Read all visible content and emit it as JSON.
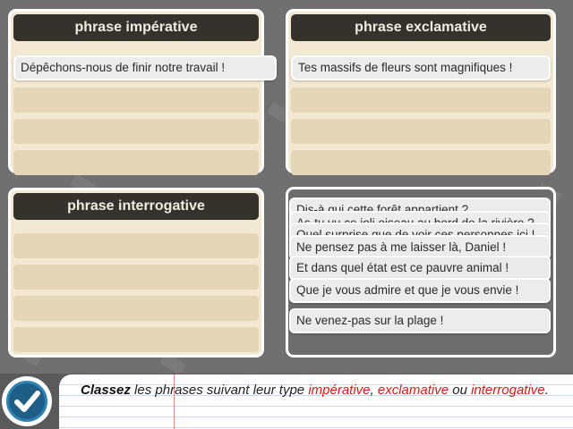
{
  "panels": {
    "imperative": {
      "title": "phrase impérative",
      "items": [
        "Dépêchons-nous de finir notre travail !"
      ]
    },
    "exclamative": {
      "title": "phrase exclamative",
      "items": [
        "Tes massifs de fleurs sont magnifiques !"
      ]
    },
    "interrogative": {
      "title": "phrase interrogative",
      "items": []
    }
  },
  "pool": {
    "stacked_partial": [
      "Dis-à qui cette forêt appartient ?",
      "As-tu vu ce joli oiseau au bord de la rivière ?",
      "Quel surprise que de voir ces personnes ici !"
    ],
    "cards": [
      "Ne pensez pas à me laisser là, Daniel !",
      "Et dans quel état est ce pauvre animal !",
      "Que je vous admire et que je vous envie !",
      "Ne venez-pas sur la plage !"
    ]
  },
  "instruction": {
    "verb": "Classez",
    "text1": " les phrases suivant leur type ",
    "type1": "impérative",
    "sep1": ", ",
    "type2": "exclamative",
    "sep2": " ou ",
    "type3": "interrogative",
    "end": "."
  },
  "colors": {
    "panel_bg": "#f3e9d2",
    "title_bg": "#35312d",
    "slot": "#e4d6b6",
    "accent_red": "#e01515",
    "check_blue": "#1f5e86"
  },
  "icons": {
    "validate": "checkmark-icon"
  }
}
